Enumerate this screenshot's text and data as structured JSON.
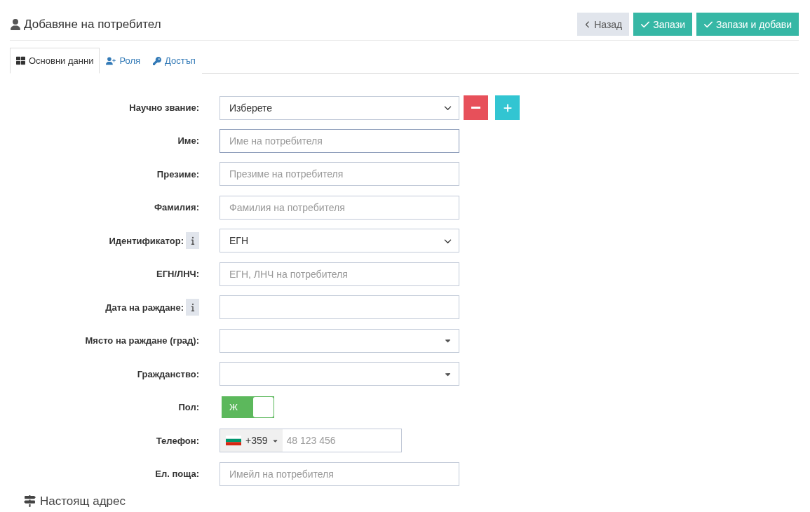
{
  "header": {
    "title": "Добавяне на потребител",
    "buttons": [
      {
        "kind": "back",
        "label": "Назад"
      },
      {
        "kind": "save",
        "label": "Запази"
      },
      {
        "kind": "save",
        "label": "Запази и добави"
      }
    ]
  },
  "tabs": [
    {
      "label": "Основни данни",
      "selected": true
    },
    {
      "label": "Роля",
      "selected": false
    },
    {
      "label": "Достъп",
      "selected": false
    }
  ],
  "fields": [
    {
      "kind": "select",
      "label": "Научно звание:",
      "value": "Изберете",
      "actions": true
    },
    {
      "kind": "text",
      "label": "Име:",
      "placeholder": "Име на потребителя",
      "focused": true
    },
    {
      "kind": "text",
      "label": "Презиме:",
      "placeholder": "Презиме на потребителя",
      "focused": false
    },
    {
      "kind": "text",
      "label": "Фамилия:",
      "placeholder": "Фамилия на потребителя",
      "focused": false
    },
    {
      "kind": "select",
      "label": "Идентификатор:",
      "value": "ЕГН",
      "info": true
    },
    {
      "kind": "text",
      "label": "ЕГН/ЛНЧ:",
      "placeholder": "ЕГН, ЛНЧ на потребителя",
      "focused": false
    },
    {
      "kind": "text",
      "label": "Дата на раждане:",
      "info": true,
      "focused": false
    },
    {
      "kind": "combo",
      "label": "Място на раждане (град):"
    },
    {
      "kind": "combo",
      "label": "Гражданство:"
    },
    {
      "kind": "toggle",
      "label": "Пол:",
      "text": "Ж",
      "on": true
    },
    {
      "kind": "phone",
      "label": "Телефон:",
      "code": "+359",
      "placeholder": "48 123 456"
    },
    {
      "kind": "text",
      "label": "Ел. поща:",
      "placeholder": "Имейл на потребителя",
      "focused": false
    }
  ],
  "section": {
    "title": "Настоящ адрес"
  }
}
